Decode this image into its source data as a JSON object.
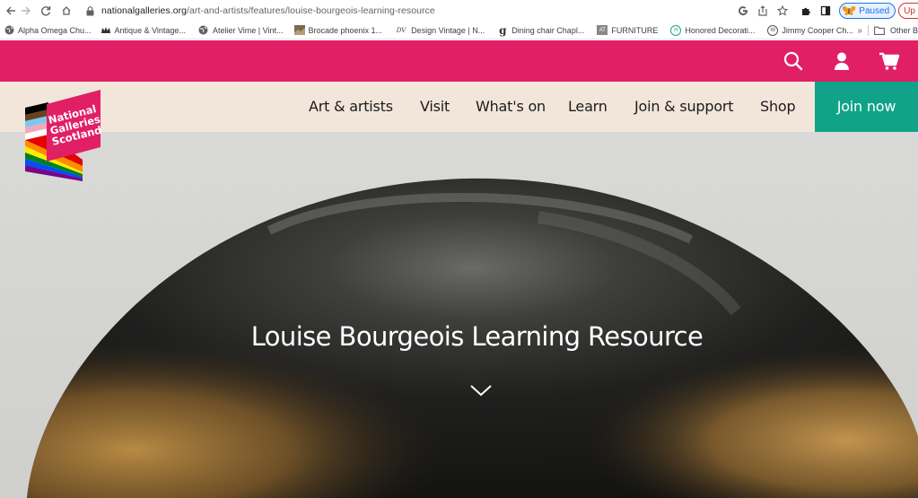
{
  "browser": {
    "url_host": "nationalgalleries.org",
    "url_path": "/art-and-artists/features/louise-bourgeois-learning-resource",
    "profile_label": "Paused",
    "update_label": "Up",
    "icons": [
      "back-icon",
      "forward-icon",
      "reload-icon",
      "home-icon",
      "lock-icon",
      "google-icon",
      "share-icon",
      "star-icon",
      "extensions-icon",
      "sidebar-icon"
    ]
  },
  "bookmarks": {
    "items": [
      {
        "label": "Alpha Omega Chu...",
        "icon": "globe-icon"
      },
      {
        "label": "Antique & Vintage...",
        "icon": "crown-icon"
      },
      {
        "label": "Atelier Vime | Vint...",
        "icon": "globe-icon"
      },
      {
        "label": "Brocade phoenix 1...",
        "icon": "image-icon"
      },
      {
        "label": "Design Vintage | N...",
        "icon": "dv-icon",
        "fav_text": "DV"
      },
      {
        "label": "Dining chair Chapl...",
        "icon": "g-icon",
        "fav_text": "g"
      },
      {
        "label": "FURNITURE",
        "icon": "at-icon",
        "fav_text": "AT"
      },
      {
        "label": "Honored Decorati...",
        "icon": "circle-h-icon",
        "fav_text": "H"
      },
      {
        "label": "Jimmy Cooper Ch...",
        "icon": "circle-w-icon",
        "fav_text": "W"
      }
    ],
    "overflow_label": "»",
    "other_label": "Other B"
  },
  "site": {
    "colors": {
      "brand_pink": "#e11f64",
      "nav_bg": "#f2e6da",
      "join_green": "#10a38a"
    },
    "top_icons": [
      "search-icon",
      "user-icon",
      "cart-icon"
    ],
    "logo_text": [
      "National",
      "Galleries",
      "Scotland"
    ],
    "nav": [
      "Art & artists",
      "Visit",
      "What's on",
      "Learn",
      "Join & support",
      "Shop"
    ],
    "join_label": "Join now"
  },
  "hero": {
    "title": "Louise Bourgeois Learning Resource",
    "scroll_icon": "chevron-down-icon"
  }
}
